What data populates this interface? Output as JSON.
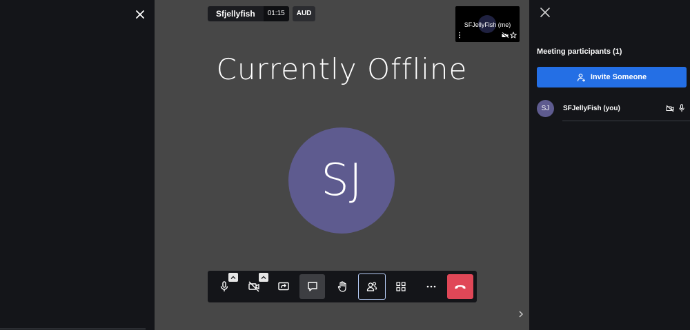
{
  "meeting": {
    "room_name": "Sfjellyfish",
    "timer": "01:15",
    "audio_badge": "AUD",
    "headline": "Currently Offline",
    "avatar_initials": "SJ"
  },
  "self_view": {
    "label": "SFJellyFish (me)"
  },
  "toolbar": {
    "buttons": [
      {
        "name": "microphone",
        "icon": "microphone-icon"
      },
      {
        "name": "camera-off",
        "icon": "camera-off-icon"
      },
      {
        "name": "share-screen",
        "icon": "share-screen-icon"
      },
      {
        "name": "chat",
        "icon": "chat-icon"
      },
      {
        "name": "raise-hand",
        "icon": "hand-icon"
      },
      {
        "name": "participants",
        "icon": "participants-icon"
      },
      {
        "name": "tile-view",
        "icon": "grid-icon"
      },
      {
        "name": "more",
        "icon": "more-icon"
      },
      {
        "name": "hang-up",
        "icon": "phone-hangup-icon"
      }
    ]
  },
  "participants_panel": {
    "title": "Meeting participants (1)",
    "invite_label": "Invite Someone",
    "participants": [
      {
        "initials": "SJ",
        "name": "SFJellyFish (you)"
      }
    ]
  },
  "colors": {
    "stage_bg": "#474747",
    "panel_bg": "#141519",
    "avatar": "#5e5b8f",
    "invite_blue": "#246fe5",
    "hangup_red": "#e04757"
  }
}
